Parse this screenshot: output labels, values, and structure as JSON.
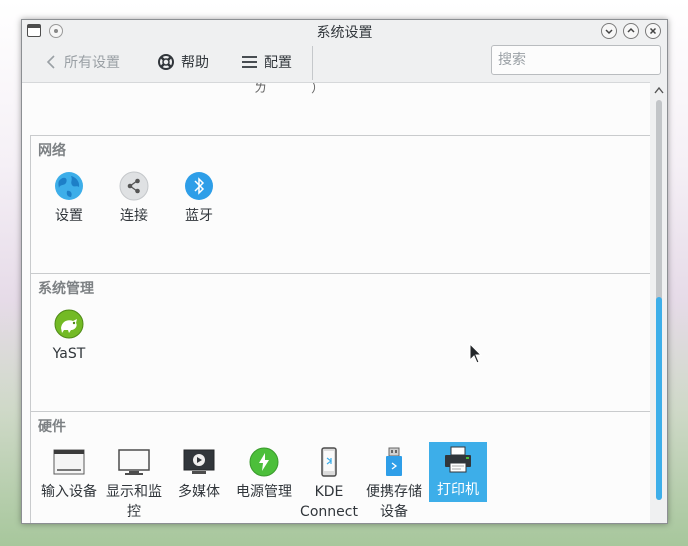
{
  "window": {
    "title": "系统设置"
  },
  "toolbar": {
    "back_label": "所有设置",
    "help_label": "帮助",
    "configure_label": "配置",
    "search_placeholder": "搜索"
  },
  "content": {
    "cutoff_text": "ㄌ ）"
  },
  "categories": [
    {
      "title": "网络",
      "items": [
        {
          "label": "设置",
          "icon": "globe-icon"
        },
        {
          "label": "连接",
          "icon": "share-icon"
        },
        {
          "label": "蓝牙",
          "icon": "bluetooth-icon"
        }
      ]
    },
    {
      "title": "系统管理",
      "items": [
        {
          "label": "YaST",
          "icon": "yast-chameleon-icon"
        }
      ]
    },
    {
      "title": "硬件",
      "items": [
        {
          "label": "输入设备",
          "icon": "keyboard-icon"
        },
        {
          "label": "显示和监控",
          "icon": "monitor-icon"
        },
        {
          "label": "多媒体",
          "icon": "multimedia-icon"
        },
        {
          "label": "电源管理",
          "icon": "power-icon"
        },
        {
          "label": "KDE Connect",
          "icon": "phone-icon"
        },
        {
          "label": "便携存储设备",
          "icon": "usb-storage-icon"
        },
        {
          "label": "打印机",
          "icon": "printer-icon",
          "selected": true
        }
      ]
    }
  ],
  "colors": {
    "accent": "#3daee9",
    "window_bg": "#eff0f1",
    "content_bg": "#fcfcfc"
  }
}
